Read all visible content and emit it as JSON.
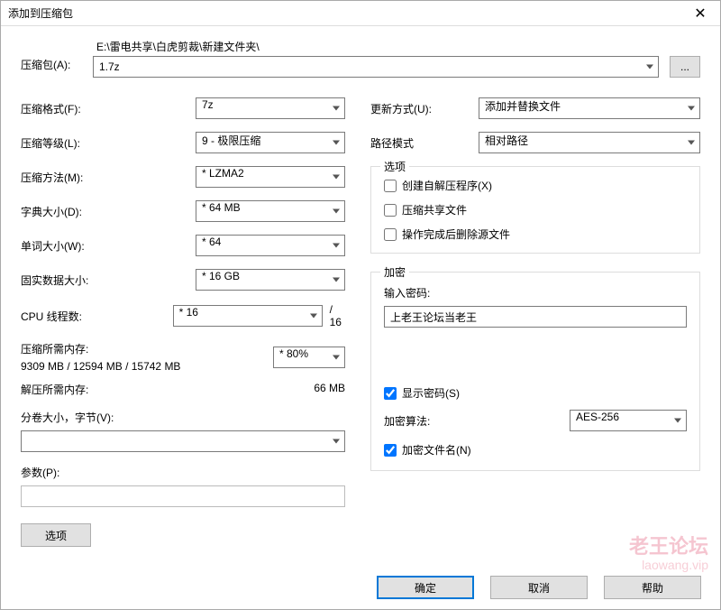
{
  "window": {
    "title": "添加到压缩包",
    "close": "✕"
  },
  "archive": {
    "label": "压缩包(A):",
    "path": "E:\\雷电共享\\白虎剪裁\\新建文件夹\\",
    "file": "1.7z",
    "browse": "..."
  },
  "left": {
    "format": {
      "label": "压缩格式(F):",
      "value": "7z"
    },
    "level": {
      "label": "压缩等级(L):",
      "value": "9 - 极限压缩"
    },
    "method": {
      "label": "压缩方法(M):",
      "value": "* LZMA2"
    },
    "dict": {
      "label": "字典大小(D):",
      "value": "* 64 MB"
    },
    "word": {
      "label": "单词大小(W):",
      "value": "* 64"
    },
    "solid": {
      "label": "固实数据大小:",
      "value": "* 16 GB"
    },
    "threads": {
      "label": "CPU 线程数:",
      "value": "* 16",
      "total": "/ 16"
    },
    "memc": {
      "label": "压缩所需内存:",
      "detail": "9309 MB / 12594 MB / 15742 MB",
      "pct": "* 80%"
    },
    "memd": {
      "label": "解压所需内存:",
      "value": "66 MB"
    },
    "split": {
      "label": "分卷大小，字节(V):",
      "value": ""
    },
    "params": {
      "label": "参数(P):",
      "value": ""
    },
    "opts": "选项"
  },
  "right": {
    "update": {
      "label": "更新方式(U):",
      "value": "添加并替换文件"
    },
    "pathmode": {
      "label": "路径模式",
      "value": "相对路径"
    },
    "options": {
      "legend": "选项",
      "sfx": "创建自解压程序(X)",
      "shared": "压缩共享文件",
      "del": "操作完成后删除源文件"
    },
    "enc": {
      "legend": "加密",
      "pwd_label": "输入密码:",
      "pwd_value": "上老王论坛当老王",
      "show": "显示密码(S)",
      "algo_label": "加密算法:",
      "algo_value": "AES-256",
      "names": "加密文件名(N)"
    }
  },
  "footer": {
    "ok": "确定",
    "cancel": "取消",
    "help": "帮助"
  },
  "wm": {
    "a": "老王论坛",
    "b": "laowang.vip"
  }
}
